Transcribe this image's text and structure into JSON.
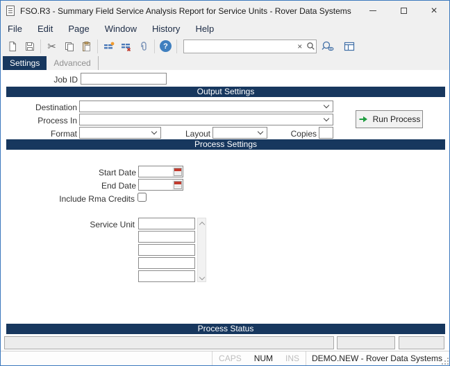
{
  "window": {
    "title": "FSO.R3 - Summary Field Service Analysis Report for Service Units - Rover Data Systems"
  },
  "menu": {
    "items": [
      "File",
      "Edit",
      "Page",
      "Window",
      "History",
      "Help"
    ]
  },
  "toolbar": {
    "search": {
      "value": "",
      "placeholder": ""
    }
  },
  "tabs": {
    "settings": "Settings",
    "advanced": "Advanced"
  },
  "form": {
    "job_id": {
      "label": "Job ID",
      "value": ""
    },
    "output_settings": {
      "title": "Output Settings",
      "destination": {
        "label": "Destination",
        "value": ""
      },
      "process_in": {
        "label": "Process In",
        "value": ""
      },
      "format": {
        "label": "Format",
        "value": ""
      },
      "layout": {
        "label": "Layout",
        "value": ""
      },
      "copies": {
        "label": "Copies",
        "value": ""
      }
    },
    "run_button": {
      "label": "Run Process"
    },
    "process_settings": {
      "title": "Process Settings",
      "start_date": {
        "label": "Start Date",
        "value": ""
      },
      "end_date": {
        "label": "End Date",
        "value": ""
      },
      "include_rma_credits": {
        "label": "Include Rma Credits",
        "checked": false
      },
      "service_unit": {
        "label": "Service Unit",
        "values": [
          "",
          "",
          "",
          "",
          ""
        ]
      }
    },
    "process_status": {
      "title": "Process Status",
      "message": "",
      "field2": "",
      "field3": ""
    }
  },
  "status_bar": {
    "caps": "CAPS",
    "num": "NUM",
    "ins": "INS",
    "connection": "DEMO.NEW - Rover Data Systems"
  },
  "colors": {
    "section_header": "#17375e",
    "active_tab": "#17375e",
    "window_border": "#3b78bd",
    "run_arrow": "#1f9d40",
    "calendar_red": "#c23b2e",
    "help_blue": "#3f7fbf"
  }
}
